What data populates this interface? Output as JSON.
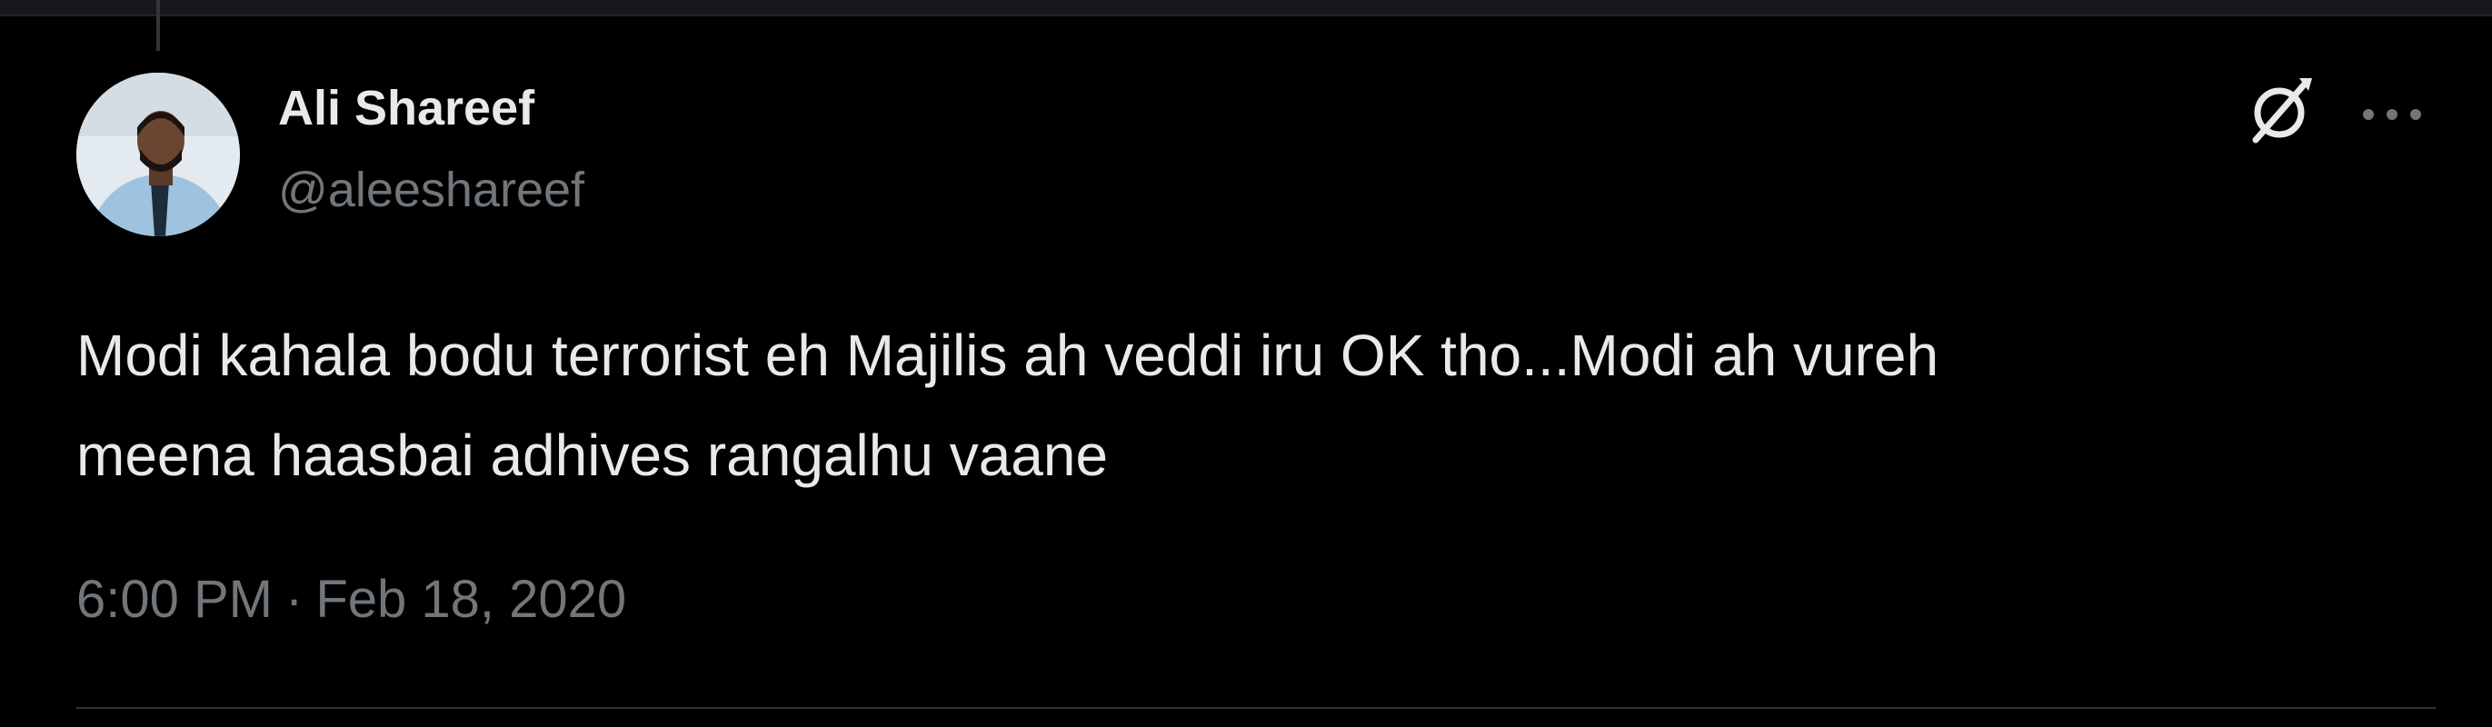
{
  "author": {
    "display_name": "Ali Shareef",
    "handle": "@aleeshareef"
  },
  "tweet": {
    "text_lines": [
      "Modi kahala bodu terrorist eh Majilis ah veddi iru OK tho...Modi ah vureh",
      "meena haasbai adhives rangalhu vaane"
    ],
    "time": "6:00 PM",
    "separator": "·",
    "date": "Feb 18, 2020"
  },
  "actions": {
    "grok_icon": "grok-icon",
    "more_icon": "more-icon"
  },
  "colors": {
    "background": "#000000",
    "text": "#e7e9ea",
    "secondary_text": "#71767b",
    "divider": "#2f3336"
  }
}
